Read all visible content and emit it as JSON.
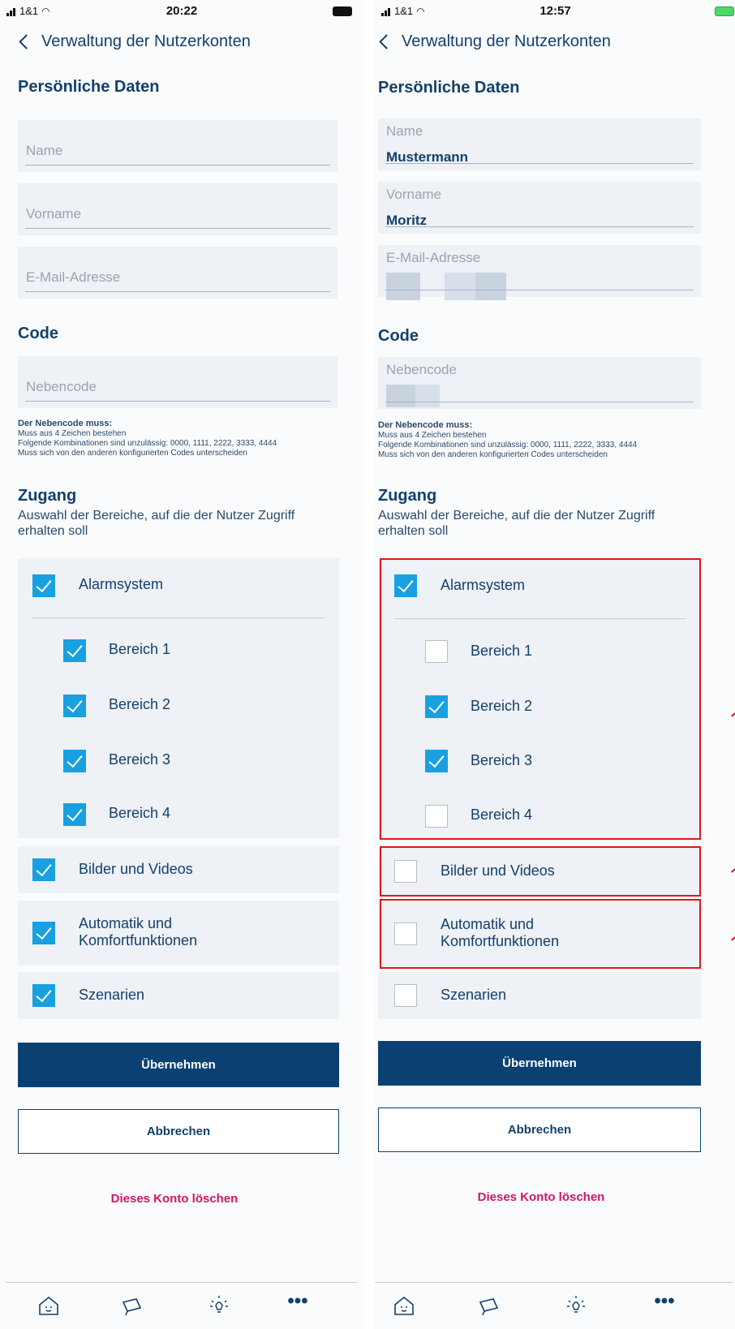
{
  "screens": [
    {
      "status": {
        "carrier": "1&1",
        "time": "20:22"
      },
      "nav": {
        "back_label": "Verwaltung der Nutzerkonten"
      },
      "personal": {
        "title": "Persönliche Daten",
        "name_placeholder": "Name",
        "firstname_placeholder": "Vorname",
        "email_placeholder": "E-Mail-Adresse"
      },
      "code": {
        "title": "Code",
        "subcode_placeholder": "Nebencode",
        "hint_title": "Der Nebencode muss:",
        "hint_1": "Muss aus 4 Zeichen bestehen",
        "hint_2": "Folgende Kombinationen sind unzulässig: 0000, 1111, 2222, 3333, 4444",
        "hint_3": "Muss sich von den anderen konfigurierten Codes unterscheiden"
      },
      "access": {
        "title": "Zugang",
        "subtitle": "Auswahl der Bereiche, auf die der Nutzer Zugriff erhalten soll",
        "alarm": "Alarmsystem",
        "area1": "Bereich 1",
        "area2": "Bereich 2",
        "area3": "Bereich 3",
        "area4": "Bereich 4",
        "images": "Bilder und Videos",
        "auto1": "Automatik und",
        "auto2": "Komfortfunktionen",
        "scenes": "Szenarien"
      },
      "buttons": {
        "apply": "Übernehmen",
        "cancel": "Abbrechen",
        "delete": "Dieses Konto löschen"
      }
    },
    {
      "status": {
        "carrier": "1&1",
        "time": "12:57"
      },
      "nav": {
        "back_label": "Verwaltung der Nutzerkonten"
      },
      "personal": {
        "title": "Persönliche Daten",
        "name_label": "Name",
        "name_value": "Mustermann",
        "firstname_label": "Vorname",
        "firstname_value": "Moritz",
        "email_label": "E-Mail-Adresse"
      },
      "code": {
        "title": "Code",
        "subcode_label": "Nebencode",
        "hint_title": "Der Nebencode muss:",
        "hint_1": "Muss aus 4 Zeichen bestehen",
        "hint_2": "Folgende Kombinationen sind unzulässig: 0000, 1111, 2222, 3333, 4444",
        "hint_3": "Muss sich von den anderen konfigurierten Codes unterscheiden"
      },
      "access": {
        "title": "Zugang",
        "subtitle": "Auswahl der Bereiche, auf die der Nutzer Zugriff erhalten soll",
        "alarm": "Alarmsystem",
        "area1": "Bereich 1",
        "area2": "Bereich 2",
        "area3": "Bereich 3",
        "area4": "Bereich 4",
        "images": "Bilder und Videos",
        "auto1": "Automatik und",
        "auto2": "Komfortfunktionen",
        "scenes": "Szenarien"
      },
      "buttons": {
        "apply": "Übernehmen",
        "cancel": "Abbrechen",
        "delete": "Dieses Konto löschen"
      }
    }
  ],
  "checkbox_states": {
    "left": {
      "alarm": true,
      "area1": true,
      "area2": true,
      "area3": true,
      "area4": true,
      "images": true,
      "auto": true,
      "scenes": true
    },
    "right": {
      "alarm": true,
      "area1": false,
      "area2": true,
      "area3": true,
      "area4": false,
      "images": false,
      "auto": false,
      "scenes": false
    }
  },
  "colors": {
    "primary": "#0b4172",
    "text": "#13406b",
    "check": "#19a0e0",
    "delete": "#d31565",
    "highlight": "#e0161b",
    "field_bg": "#eef1f6"
  },
  "icons": [
    "home-icon",
    "camera-icon",
    "lightbulb-icon",
    "more-icon"
  ]
}
